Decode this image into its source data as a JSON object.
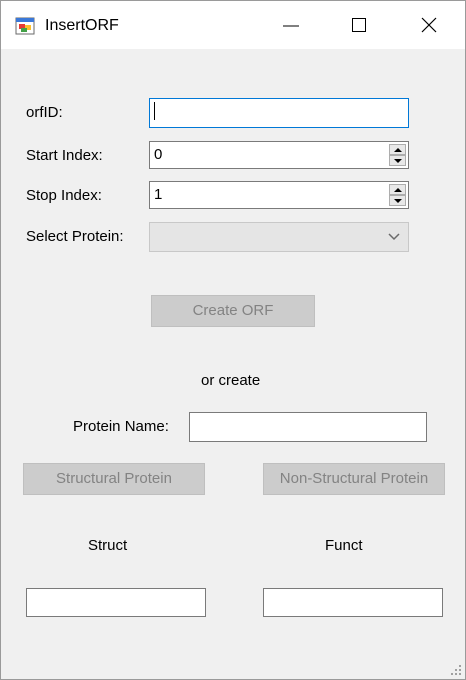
{
  "window": {
    "title": "InsertORF",
    "icon": "winforms-app-icon"
  },
  "titlebar_buttons": {
    "minimize": "minimize-icon",
    "maximize": "maximize-icon",
    "close": "close-icon"
  },
  "form": {
    "orf_id_label": "orfID:",
    "orf_id_value": "",
    "start_index_label": "Start Index:",
    "start_index_value": "0",
    "stop_index_label": "Stop Index:",
    "stop_index_value": "1",
    "select_protein_label": "Select Protein:",
    "select_protein_value": "",
    "create_orf_button": "Create ORF",
    "or_create_text": "or create",
    "protein_name_label": "Protein Name:",
    "protein_name_value": "",
    "structural_button": "Structural Protein",
    "non_structural_button": "Non-Structural Protein",
    "struct_label": "Struct",
    "funct_label": "Funct",
    "struct_value": "",
    "funct_value": ""
  },
  "colors": {
    "focus_border": "#0078d7",
    "disabled_button": "#cccccc",
    "disabled_text": "#838383"
  }
}
